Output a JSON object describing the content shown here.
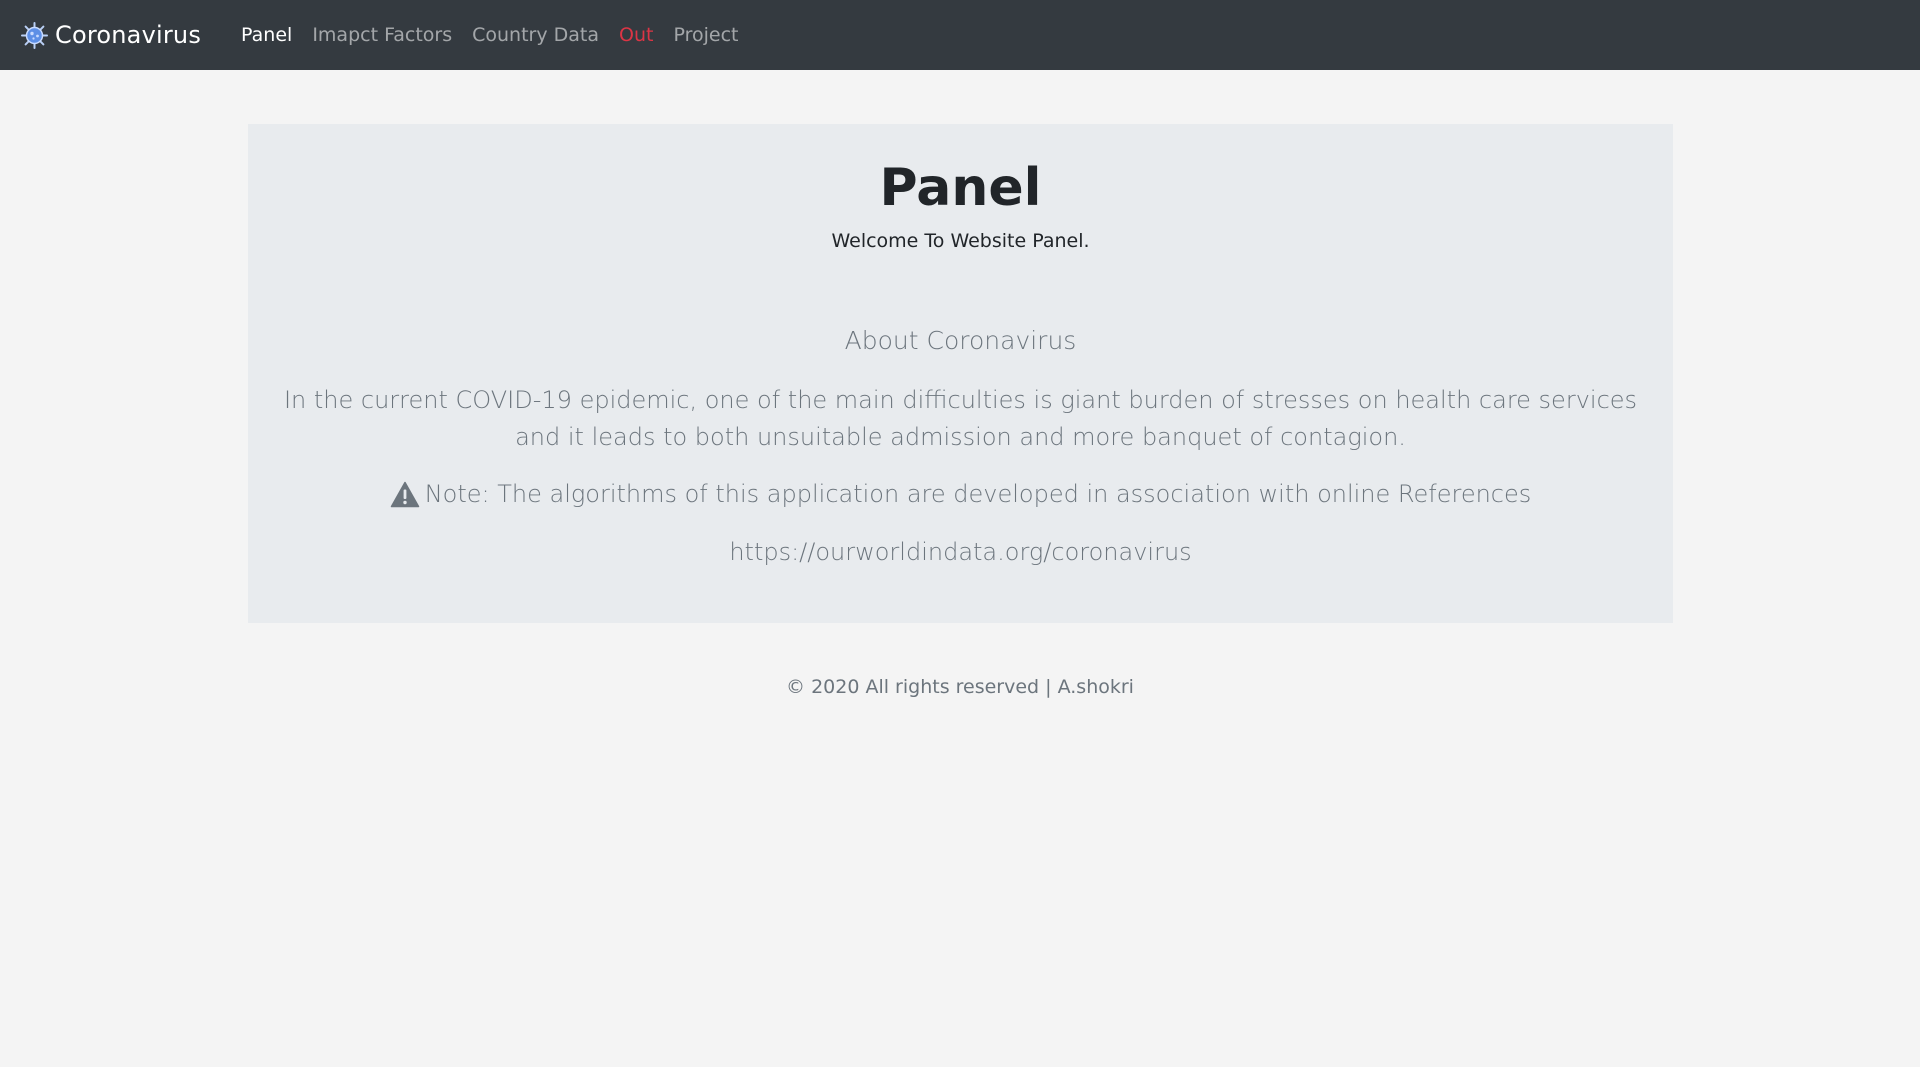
{
  "navbar": {
    "brand_text": "Coronavirus",
    "brand_icon": "virus-icon",
    "links": [
      {
        "label": "Panel",
        "state": "active"
      },
      {
        "label": "Imapct Factors",
        "state": "normal"
      },
      {
        "label": "Country Data",
        "state": "normal"
      },
      {
        "label": "Out",
        "state": "danger"
      },
      {
        "label": "Project",
        "state": "normal"
      }
    ]
  },
  "main": {
    "title": "Panel",
    "subtitle": "Welcome To Website Panel.",
    "about_heading": "About Coronavirus",
    "about_text": "In the current COVID-19 epidemic, one of the main difficulties is giant burden of stresses on health care services and it leads to both unsuitable admission and more banquet of contagion.",
    "note_icon": "warning-icon",
    "note_text": "Note: The algorithms of this application are developed in association with online References",
    "reference_link": "https://ourworldindata.org/coronavirus"
  },
  "footer": {
    "text": "© 2020 All rights reserved | A.shokri"
  },
  "colors": {
    "navbar_bg": "#343a40",
    "page_bg": "#f4f4f4",
    "jumbotron_bg": "#e8ebee",
    "danger": "#dc3545",
    "muted": "#6c757d",
    "brand_icon": "#8fb4ff"
  }
}
